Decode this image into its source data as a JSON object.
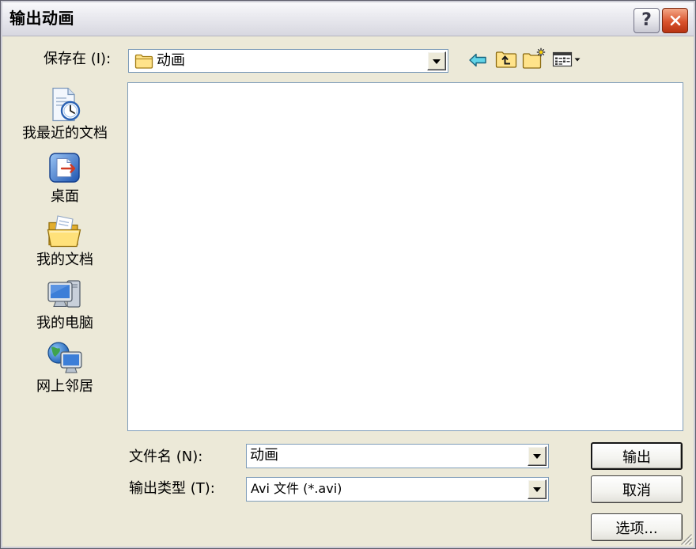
{
  "window": {
    "title": "输出动画",
    "help_glyph": "?",
    "close_icon": "close-icon"
  },
  "location": {
    "label": "保存在 (I):",
    "value": "动画",
    "icon": "folder-icon"
  },
  "toolbar": {
    "icons": [
      "back-arrow-icon",
      "up-folder-icon",
      "new-folder-icon",
      "view-menu-icon"
    ]
  },
  "places": [
    {
      "label": "我最近的文档",
      "icon": "recent-documents-icon"
    },
    {
      "label": "桌面",
      "icon": "desktop-icon"
    },
    {
      "label": "我的文档",
      "icon": "my-documents-icon"
    },
    {
      "label": "我的电脑",
      "icon": "my-computer-icon"
    },
    {
      "label": "网上邻居",
      "icon": "network-places-icon"
    }
  ],
  "file_name": {
    "label": "文件名 (N):",
    "value": "动画"
  },
  "file_type": {
    "label": "输出类型 (T):",
    "value": "Avi 文件 (*.avi)"
  },
  "buttons": {
    "output": "输出",
    "cancel": "取消",
    "options": "选项..."
  },
  "colors": {
    "dialog_bg": "#ECE9D8",
    "list_bg": "#FFFFFF",
    "field_border": "#7F9DB9",
    "close_button": "#D9532D",
    "back_arrow": "#62D5E8",
    "folder_yellow": "#FFE38A"
  }
}
